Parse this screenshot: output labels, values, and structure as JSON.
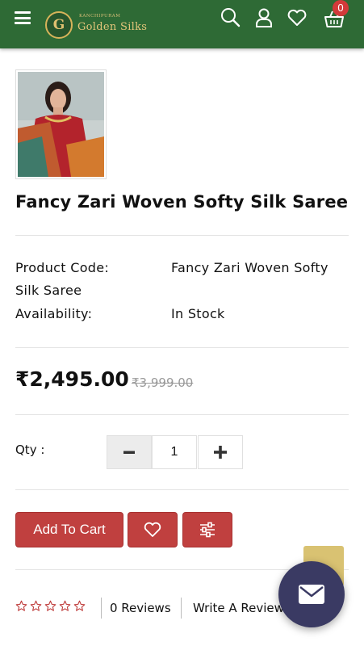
{
  "header": {
    "logo_letter": "G",
    "logo_subtitle": "KANCHIPURAM",
    "logo_name": "Golden Silks",
    "cart_count": "0",
    "icons": [
      "menu-icon",
      "search-icon",
      "user-icon",
      "heart-icon",
      "basket-icon"
    ],
    "bg_color": "#2e6a35"
  },
  "product": {
    "title": "Fancy Zari Woven Softy Silk Saree",
    "code_label": "Product Code:",
    "code_value_line1": "Fancy Zari Woven Softy",
    "code_value_line2": "Silk Saree",
    "availability_label": "Availability:",
    "availability_value": "In Stock",
    "price": "₹2,495.00",
    "old_price": "₹3,999.00"
  },
  "quantity": {
    "label": "Qty :",
    "value": "1"
  },
  "actions": {
    "add_to_cart": "Add To Cart",
    "wishlist_icon": "heart-icon",
    "compare_icon": "sliders-icon",
    "accent": "#c0403f"
  },
  "reviews": {
    "rating": 0,
    "max_rating": 5,
    "count_label": "0 Reviews",
    "write_label": "Write A Review"
  }
}
